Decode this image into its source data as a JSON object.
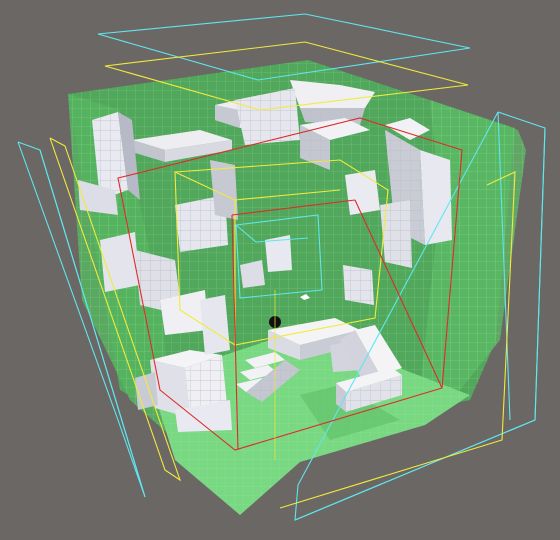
{
  "scene": {
    "view": "3d-scene-viewport",
    "background": "#6b6764",
    "wall_color": "#4fae5a",
    "floor_color": "#74d27c",
    "grid_color": "#9fe0a6",
    "block_color": "#eeeef2",
    "block_shade_color": "#9aa0b0",
    "bound_colors": {
      "outer": "#5fe6ee",
      "middle": "#f2ea3c",
      "inner": "#e02a2a"
    },
    "player_marker_color": "#111111",
    "gizmo_color": "#ffffff"
  }
}
